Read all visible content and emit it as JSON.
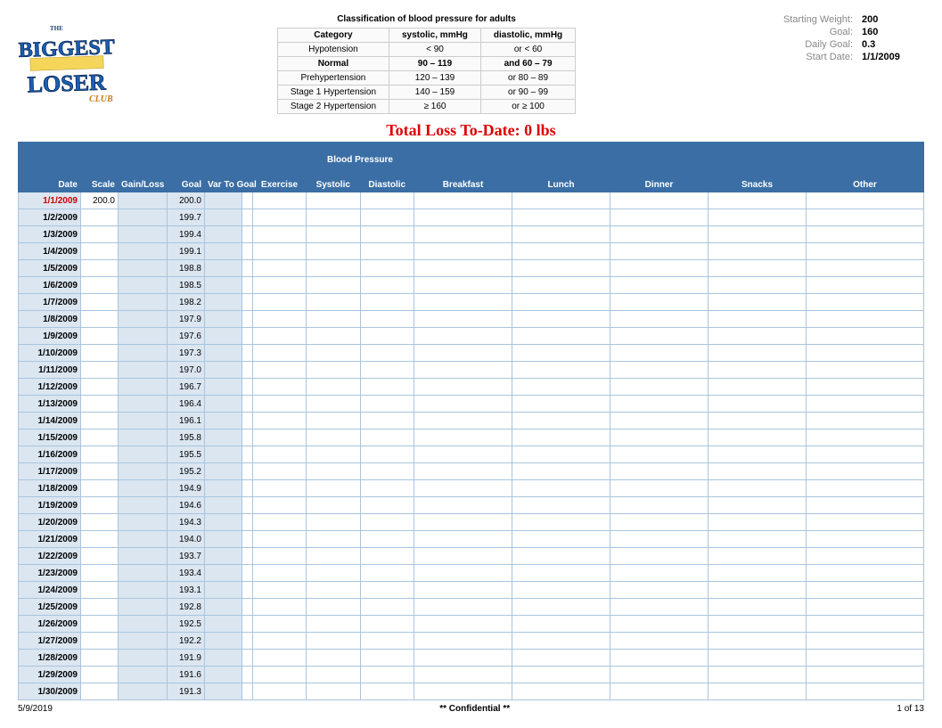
{
  "logo": {
    "line1": "THE",
    "line2": "BIGGEST",
    "line3": "LOSER",
    "line4": "CLUB"
  },
  "bp": {
    "title": "Classification of blood pressure for adults",
    "headers": [
      "Category",
      "systolic, mmHg",
      "diastolic, mmHg"
    ],
    "rows": [
      [
        "Hypotension",
        "< 90",
        "or < 60"
      ],
      [
        "Normal",
        "90 – 119",
        "and 60 – 79"
      ],
      [
        "Prehypertension",
        "120 – 139",
        "or 80 – 89"
      ],
      [
        "Stage 1 Hypertension",
        "140 – 159",
        "or 90 – 99"
      ],
      [
        "Stage 2 Hypertension",
        "≥ 160",
        "or ≥ 100"
      ]
    ]
  },
  "stats": {
    "starting_weight_label": "Starting Weight:",
    "starting_weight": "200",
    "goal_label": "Goal:",
    "goal": "160",
    "daily_goal_label": "Daily Goal:",
    "daily_goal": "0.3",
    "start_date_label": "Start Date:",
    "start_date": "1/1/2009"
  },
  "total_loss": "Total Loss To-Date: 0 lbs",
  "headers": {
    "date": "Date",
    "scale": "Scale",
    "gl": "Gain/Loss",
    "goal": "Goal",
    "var": "Var To Goal",
    "ex": "Exercise",
    "bp_group": "Blood Pressure",
    "sys": "Systolic",
    "dia": "Diastolic",
    "bf": "Breakfast",
    "lu": "Lunch",
    "di": "Dinner",
    "sn": "Snacks",
    "ot": "Other"
  },
  "rows": [
    {
      "date": "1/1/2009",
      "scale": "200.0",
      "gl": "",
      "goal": "200.0"
    },
    {
      "date": "1/2/2009",
      "scale": "",
      "gl": "",
      "goal": "199.7"
    },
    {
      "date": "1/3/2009",
      "scale": "",
      "gl": "",
      "goal": "199.4"
    },
    {
      "date": "1/4/2009",
      "scale": "",
      "gl": "",
      "goal": "199.1"
    },
    {
      "date": "1/5/2009",
      "scale": "",
      "gl": "",
      "goal": "198.8"
    },
    {
      "date": "1/6/2009",
      "scale": "",
      "gl": "",
      "goal": "198.5"
    },
    {
      "date": "1/7/2009",
      "scale": "",
      "gl": "",
      "goal": "198.2"
    },
    {
      "date": "1/8/2009",
      "scale": "",
      "gl": "",
      "goal": "197.9"
    },
    {
      "date": "1/9/2009",
      "scale": "",
      "gl": "",
      "goal": "197.6"
    },
    {
      "date": "1/10/2009",
      "scale": "",
      "gl": "",
      "goal": "197.3"
    },
    {
      "date": "1/11/2009",
      "scale": "",
      "gl": "",
      "goal": "197.0"
    },
    {
      "date": "1/12/2009",
      "scale": "",
      "gl": "",
      "goal": "196.7"
    },
    {
      "date": "1/13/2009",
      "scale": "",
      "gl": "",
      "goal": "196.4"
    },
    {
      "date": "1/14/2009",
      "scale": "",
      "gl": "",
      "goal": "196.1"
    },
    {
      "date": "1/15/2009",
      "scale": "",
      "gl": "",
      "goal": "195.8"
    },
    {
      "date": "1/16/2009",
      "scale": "",
      "gl": "",
      "goal": "195.5"
    },
    {
      "date": "1/17/2009",
      "scale": "",
      "gl": "",
      "goal": "195.2"
    },
    {
      "date": "1/18/2009",
      "scale": "",
      "gl": "",
      "goal": "194.9"
    },
    {
      "date": "1/19/2009",
      "scale": "",
      "gl": "",
      "goal": "194.6"
    },
    {
      "date": "1/20/2009",
      "scale": "",
      "gl": "",
      "goal": "194.3"
    },
    {
      "date": "1/21/2009",
      "scale": "",
      "gl": "",
      "goal": "194.0"
    },
    {
      "date": "1/22/2009",
      "scale": "",
      "gl": "",
      "goal": "193.7"
    },
    {
      "date": "1/23/2009",
      "scale": "",
      "gl": "",
      "goal": "193.4"
    },
    {
      "date": "1/24/2009",
      "scale": "",
      "gl": "",
      "goal": "193.1"
    },
    {
      "date": "1/25/2009",
      "scale": "",
      "gl": "",
      "goal": "192.8"
    },
    {
      "date": "1/26/2009",
      "scale": "",
      "gl": "",
      "goal": "192.5"
    },
    {
      "date": "1/27/2009",
      "scale": "",
      "gl": "",
      "goal": "192.2"
    },
    {
      "date": "1/28/2009",
      "scale": "",
      "gl": "",
      "goal": "191.9"
    },
    {
      "date": "1/29/2009",
      "scale": "",
      "gl": "",
      "goal": "191.6"
    },
    {
      "date": "1/30/2009",
      "scale": "",
      "gl": "",
      "goal": "191.3"
    }
  ],
  "footer": {
    "date": "5/9/2019",
    "conf": "** Confidential **",
    "page": "1 of 13"
  }
}
